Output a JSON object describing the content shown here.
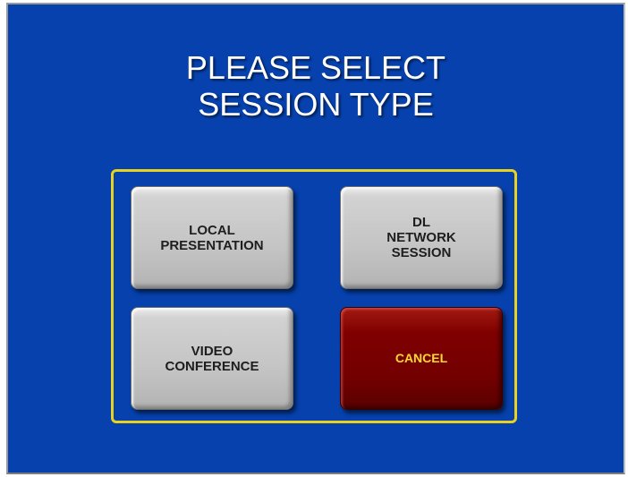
{
  "title": {
    "line1": "PLEASE SELECT",
    "line2": "SESSION TYPE"
  },
  "buttons": {
    "local_presentation": {
      "line1": "LOCAL",
      "line2": "PRESENTATION"
    },
    "dl_network_session": {
      "line1": "DL",
      "line2": "NETWORK",
      "line3": "SESSION"
    },
    "video_conference": {
      "line1": "VIDEO",
      "line2": "CONFERENCE"
    },
    "cancel": {
      "label": "CANCEL"
    }
  },
  "colors": {
    "background": "#0641ad",
    "frame": "#e8d21e",
    "button_grey": "#c4c4c4",
    "button_cancel": "#7f0000",
    "cancel_text": "#ffdb2a"
  }
}
